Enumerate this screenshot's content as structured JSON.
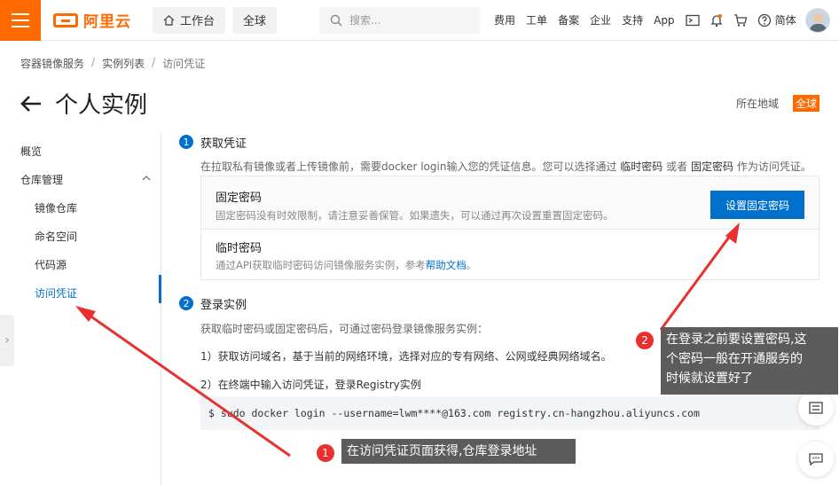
{
  "header": {
    "logo_text": "阿里云",
    "workbench": "工作台",
    "region": "全球",
    "search_placeholder": "搜索...",
    "links": [
      "费用",
      "工单",
      "备案",
      "企业",
      "支持",
      "App"
    ],
    "lang": "简体"
  },
  "breadcrumb": [
    "容器镜像服务",
    "实例列表",
    "访问凭证"
  ],
  "page": {
    "title": "个人实例",
    "region_label": "所在地域",
    "region_value": "全球"
  },
  "sidebar": {
    "items": [
      "概览",
      "仓库管理",
      "镜像仓库",
      "命名空间",
      "代码源",
      "访问凭证"
    ]
  },
  "step1": {
    "num": "1",
    "title": "获取凭证",
    "desc_a": "在拉取私有镜像或者上传镜像前，需要docker login输入您的凭证信息。您可以选择通过",
    "desc_b": "临时密码",
    "desc_c": "或者",
    "desc_d": "固定密码",
    "desc_e": "作为访问凭证。",
    "fixed_title": "固定密码",
    "fixed_desc": "固定密码没有时效限制，请注意妥善保管。如果遗失，可以通过再次设置重置固定密码。",
    "fixed_button": "设置固定密码",
    "temp_title": "临时密码",
    "temp_desc_a": "通过API获取临时密码访问镜像服务实例，参考",
    "temp_link": "帮助文档",
    "temp_desc_b": "。"
  },
  "step2": {
    "num": "2",
    "title": "登录实例",
    "desc": "获取临时密码或固定密码后，可通过密码登录镜像服务实例：",
    "line1": "1）获取访问域名，基于当前的网络环境，选择对应的专有网络、公网或经典网络域名。",
    "line2": "2）在终端中输入访问凭证，登录Registry实例",
    "command": "$ sudo docker login --username=lwm****@163.com registry.cn-hangzhou.aliyuncs.com"
  },
  "annotations": {
    "a1_num": "1",
    "a1_text": "在访问凭证页面获得,仓库登录地址",
    "a2_num": "2",
    "a2_line1": "在登录之前要设置密码,这",
    "a2_line2": "个密码一般在开通服务的",
    "a2_line3": "时候就设置好了"
  },
  "colors": {
    "brand": "#ff6a00",
    "primary": "#0070cc",
    "annotation": "#e8312f"
  }
}
